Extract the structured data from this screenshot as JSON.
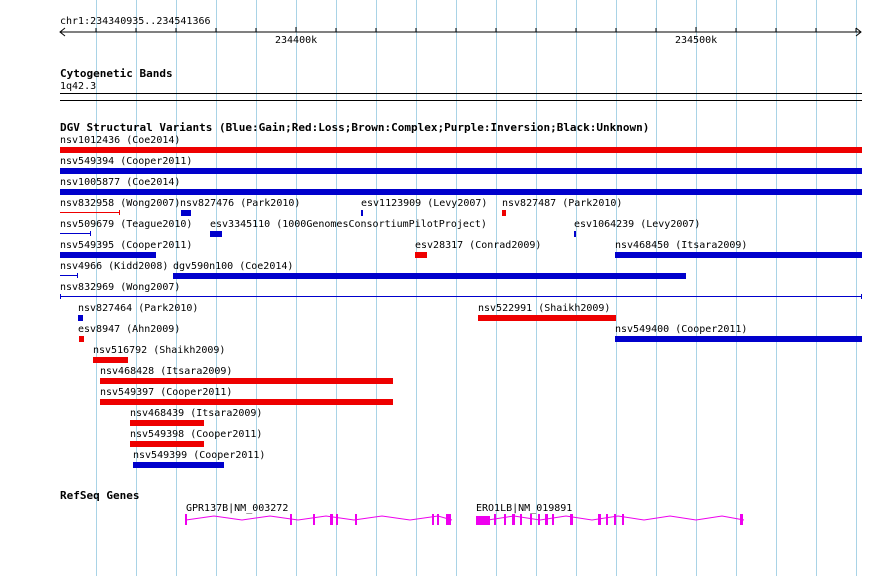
{
  "ruler": {
    "position_label": "chr1:234340935..234541366",
    "ticks": [
      "234400k",
      "234500k"
    ]
  },
  "tracks": {
    "cytogenetic": {
      "title": "Cytogenetic Bands",
      "band": "1q42.3"
    },
    "dgv": {
      "title": "DGV Structural Variants (Blue:Gain;Red:Loss;Brown:Complex;Purple:Inversion;Black:Unknown)"
    },
    "refseq": {
      "title": "RefSeq Genes"
    }
  },
  "colors": {
    "gain": "#0000cc",
    "loss": "#ee0000",
    "gene": "#ee00ee",
    "grid": "#a9d3e6"
  },
  "variants": [
    {
      "label": "nsv1012436 (Coe2014)",
      "type": "loss"
    },
    {
      "label": "nsv549394 (Cooper2011)",
      "type": "gain"
    },
    {
      "label": "nsv1005877 (Coe2014)",
      "type": "gain"
    },
    {
      "label": "nsv832958 (Wong2007)",
      "type": "loss"
    },
    {
      "label": "nsv827476 (Park2010)",
      "type": "gain"
    },
    {
      "label": "esv1123909 (Levy2007)",
      "type": "gain"
    },
    {
      "label": "nsv827487 (Park2010)",
      "type": "loss"
    },
    {
      "label": "nsv509679 (Teague2010)",
      "type": "gain"
    },
    {
      "label": "esv3345110 (1000GenomesConsortiumPilotProject)",
      "type": "gain"
    },
    {
      "label": "esv1064239 (Levy2007)",
      "type": "gain"
    },
    {
      "label": "nsv549395 (Cooper2011)",
      "type": "gain"
    },
    {
      "label": "esv28317 (Conrad2009)",
      "type": "loss"
    },
    {
      "label": "nsv468450 (Itsara2009)",
      "type": "gain"
    },
    {
      "label": "nsv4966 (Kidd2008)",
      "type": "gain"
    },
    {
      "label": "dgv590n100 (Coe2014)",
      "type": "gain"
    },
    {
      "label": "nsv832969 (Wong2007)",
      "type": "gain"
    },
    {
      "label": "nsv827464 (Park2010)",
      "type": "gain"
    },
    {
      "label": "nsv522991 (Shaikh2009)",
      "type": "loss"
    },
    {
      "label": "esv8947 (Ahn2009)",
      "type": "loss"
    },
    {
      "label": "nsv549400 (Cooper2011)",
      "type": "gain"
    },
    {
      "label": "nsv516792 (Shaikh2009)",
      "type": "loss"
    },
    {
      "label": "nsv468428 (Itsara2009)",
      "type": "loss"
    },
    {
      "label": "nsv549397 (Cooper2011)",
      "type": "loss"
    },
    {
      "label": "nsv468439 (Itsara2009)",
      "type": "loss"
    },
    {
      "label": "nsv549398 (Cooper2011)",
      "type": "loss"
    },
    {
      "label": "nsv549399 (Cooper2011)",
      "type": "gain"
    }
  ],
  "genes": [
    {
      "label": "GPR137B|NM_003272"
    },
    {
      "label": "ERO1LB|NM_019891"
    }
  ]
}
